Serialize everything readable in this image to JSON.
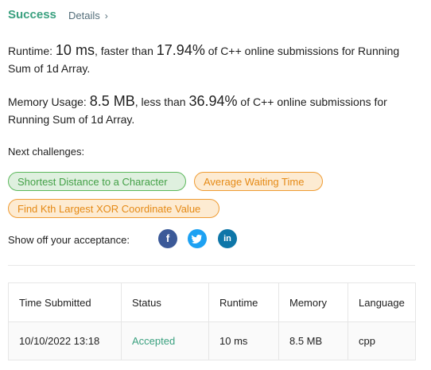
{
  "header": {
    "status": "Success",
    "details_label": "Details",
    "details_icon": "chevron-right-icon"
  },
  "runtime": {
    "label": "Runtime:",
    "value": "10 ms",
    "connector": ", faster than",
    "percent": "17.94%",
    "suffix": "of C++ online submissions for Running Sum of 1d Array."
  },
  "memory": {
    "label": "Memory Usage:",
    "value": "8.5 MB",
    "connector": ", less than",
    "percent": "36.94%",
    "suffix": "of C++ online submissions for Running Sum of 1d Array."
  },
  "challenges": {
    "label": "Next challenges:",
    "items": [
      {
        "label": "Shortest Distance to a Character",
        "difficulty": "easy",
        "color": "#5cb85c"
      },
      {
        "label": "Average Waiting Time",
        "difficulty": "medium",
        "color": "#ef9c34"
      },
      {
        "label": "Find Kth Largest XOR Coordinate Value",
        "difficulty": "medium",
        "color": "#ef9c34"
      }
    ]
  },
  "share": {
    "label": "Show off your acceptance:",
    "icons": [
      "facebook-icon",
      "twitter-icon",
      "linkedin-icon"
    ],
    "facebook_glyph": "f",
    "twitter_glyph": "t",
    "linkedin_glyph": "in"
  },
  "table": {
    "headers": [
      "Time Submitted",
      "Status",
      "Runtime",
      "Memory",
      "Language"
    ],
    "rows": [
      {
        "time": "10/10/2022 13:18",
        "status": "Accepted",
        "runtime": "10 ms",
        "memory": "8.5 MB",
        "language": "cpp"
      }
    ]
  },
  "colors": {
    "success": "#3aa07f",
    "easy": "#43a047",
    "medium": "#e58a16",
    "facebook": "#3b5998",
    "twitter": "#1da1f2",
    "linkedin": "#0e76a8"
  }
}
